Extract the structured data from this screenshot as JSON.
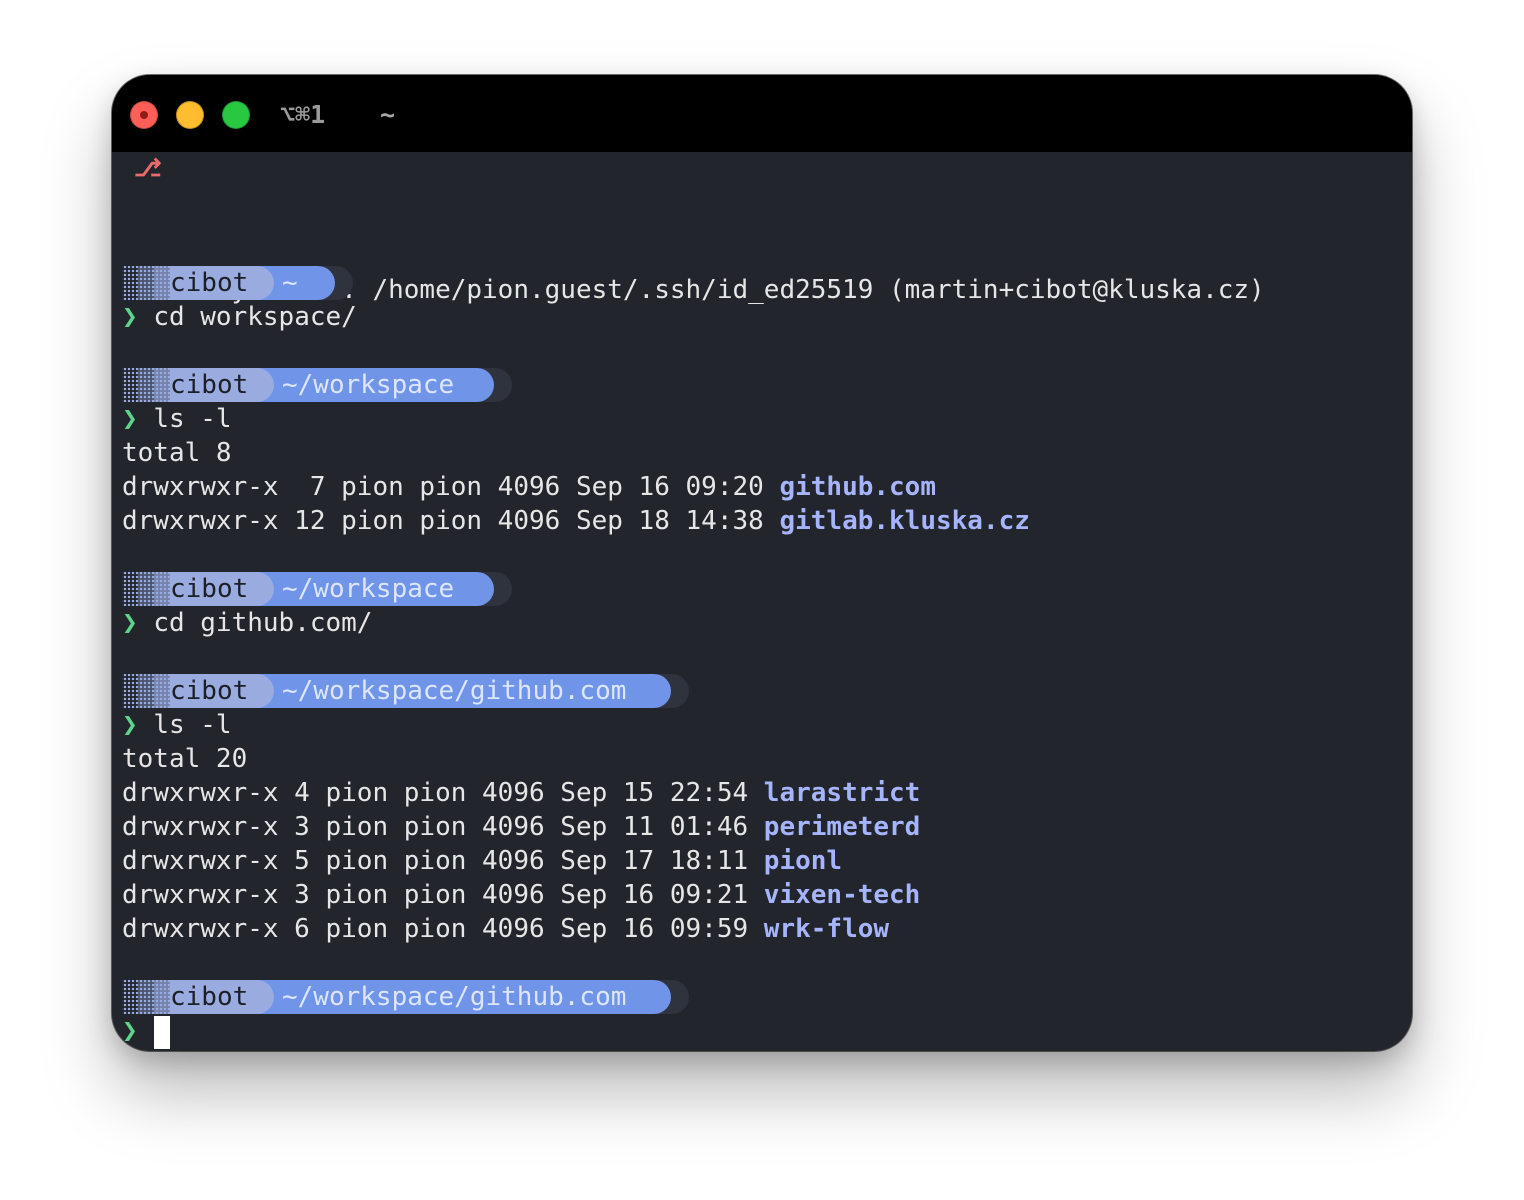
{
  "window": {
    "tab_shortcut": "⌥⌘1",
    "tab_title": "~"
  },
  "branch_glyph": "⎇",
  "identity_line": "Identity added: /home/pion.guest/.ssh/id_ed25519 (martin+cibot@kluska.cz)",
  "prompt_symbol": "❯",
  "user": "cibot",
  "blocks": [
    {
      "path": "~",
      "command": "cd workspace/"
    },
    {
      "path": "~/workspace",
      "command": "ls -l"
    },
    {
      "path": "~/workspace",
      "command": "cd github.com/"
    },
    {
      "path": "~/workspace/github.com",
      "command": "ls -l"
    },
    {
      "path": "~/workspace/github.com",
      "command": ""
    }
  ],
  "listing1": {
    "total": "total 8",
    "rows": [
      {
        "meta": "drwxrwxr-x  7 pion pion 4096 Sep 16 09:20 ",
        "name": "github.com"
      },
      {
        "meta": "drwxrwxr-x 12 pion pion 4096 Sep 18 14:38 ",
        "name": "gitlab.kluska.cz"
      }
    ]
  },
  "listing2": {
    "total": "total 20",
    "rows": [
      {
        "meta": "drwxrwxr-x 4 pion pion 4096 Sep 15 22:54 ",
        "name": "larastrict"
      },
      {
        "meta": "drwxrwxr-x 3 pion pion 4096 Sep 11 01:46 ",
        "name": "perimeterd"
      },
      {
        "meta": "drwxrwxr-x 5 pion pion 4096 Sep 17 18:11 ",
        "name": "pionl"
      },
      {
        "meta": "drwxrwxr-x 3 pion pion 4096 Sep 16 09:21 ",
        "name": "vixen-tech"
      },
      {
        "meta": "drwxrwxr-x 6 pion pion 4096 Sep 16 09:59 ",
        "name": "wrk-flow"
      }
    ]
  },
  "colors": {
    "terminal_bg": "#22252c",
    "titlebar_bg": "#000000",
    "user_segment": "#9aabe0",
    "path_segment": "#6f94e8",
    "prompt_chevron": "#5fd38d",
    "directory": "#a5b4fc"
  }
}
